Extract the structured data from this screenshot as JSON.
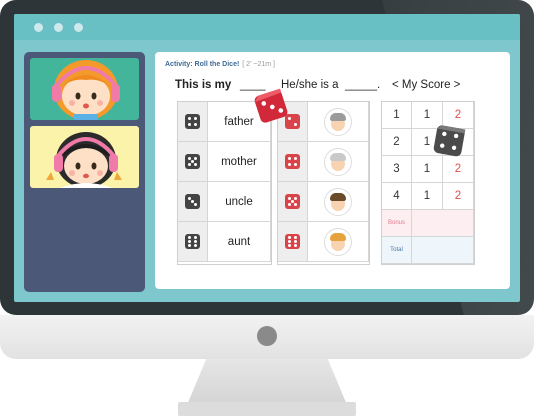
{
  "window": {
    "title": ""
  },
  "video_panel": {
    "cams": [
      {
        "name": "student-1"
      },
      {
        "name": "student-2"
      }
    ]
  },
  "activity": {
    "title": "Activity: Roll the Dice!",
    "subtitle": "[ 2' ~21m ]"
  },
  "sentence": {
    "part1": "This is  my",
    "blank1": "____",
    "part2": "He/she is a",
    "blank2": "_____.",
    "score_label": "< My Score >"
  },
  "words": [
    {
      "die": 4,
      "label": "father"
    },
    {
      "die": 5,
      "label": "mother"
    },
    {
      "die": 3,
      "label": "uncle"
    },
    {
      "die": 6,
      "label": "aunt"
    }
  ],
  "pictures": [
    {
      "die": 2,
      "icon": "grandfather-icon",
      "hair": "#9b9b9b"
    },
    {
      "die": 4,
      "icon": "grandmother-icon",
      "hair": "#c9c9c9"
    },
    {
      "die": 5,
      "icon": "boy-icon",
      "hair": "#6b4a2a"
    },
    {
      "die": 6,
      "icon": "girl-icon",
      "hair": "#e6a23c"
    }
  ],
  "score": {
    "rows": [
      {
        "num": "1",
        "a": "1",
        "b": "2"
      },
      {
        "num": "2",
        "a": "1",
        "b": ""
      },
      {
        "num": "3",
        "a": "1",
        "b": "2"
      },
      {
        "num": "4",
        "a": "1",
        "b": "2"
      }
    ],
    "bonus_label": "Bonus",
    "total_label": "Total"
  },
  "colors": {
    "screen": "#7ec7cc",
    "panel": "#4b5877",
    "die_red": "#d9434a",
    "die_black": "#444444",
    "score_red": "#e05050"
  }
}
